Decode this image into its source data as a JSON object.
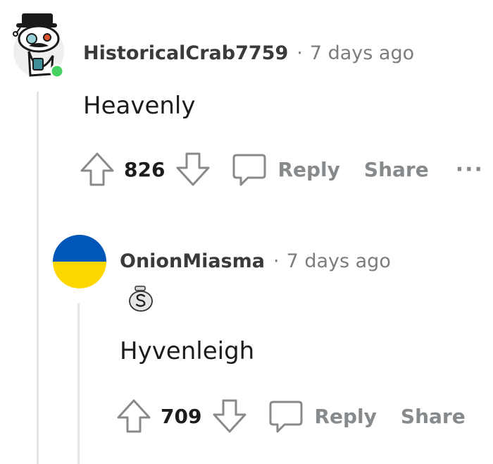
{
  "comments": [
    {
      "username": "HistoricalCrab7759",
      "separator": "·",
      "time": "7 days ago",
      "body": "Heavenly",
      "score": "826",
      "reply_label": "Reply",
      "share_label": "Share",
      "more_label": "···",
      "avatar_icon": "snoo-avatar-icon",
      "online_color": "#46d160"
    },
    {
      "username": "OnionMiasma",
      "separator": "·",
      "time": "7 days ago",
      "body": "Hyvenleigh",
      "score": "709",
      "reply_label": "Reply",
      "share_label": "Share",
      "avatar_icon": "ukraine-flag-avatar-icon",
      "flag_colors": [
        "#0057b7",
        "#ffd700"
      ],
      "flair_icon": "money-bag-icon"
    }
  ]
}
